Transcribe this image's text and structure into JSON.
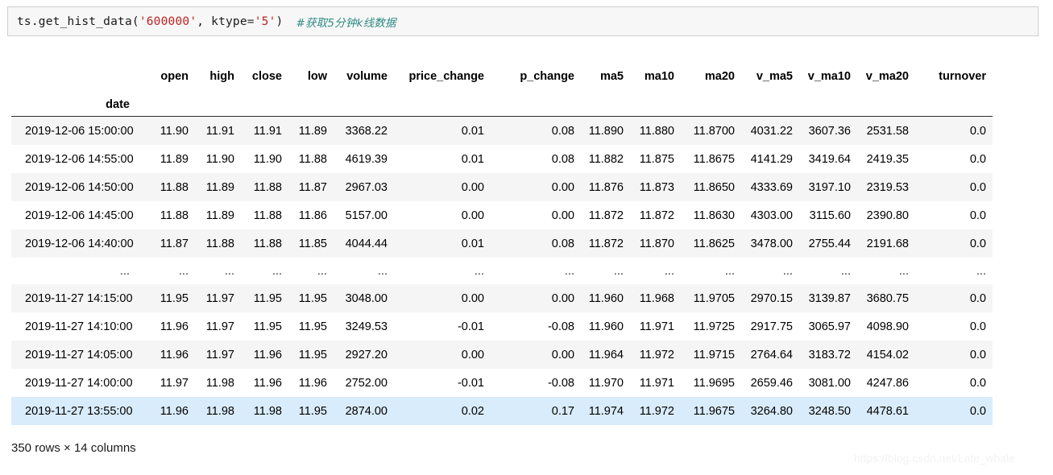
{
  "code_cell": {
    "prefix": "ts.get_hist_data(",
    "arg1": "'600000'",
    "comma": ", ",
    "kwarg_name": "ktype",
    "equals": "=",
    "arg2": "'5'",
    "close_paren": ")",
    "comment": "#获取5分钟k线数据",
    "full_text": "ts.get_hist_data('600000', ktype='5')  #获取5分钟k线数据"
  },
  "dataframe": {
    "index_name": "date",
    "columns": [
      "open",
      "high",
      "close",
      "low",
      "volume",
      "price_change",
      "p_change",
      "ma5",
      "ma10",
      "ma20",
      "v_ma5",
      "v_ma10",
      "v_ma20",
      "turnover"
    ],
    "ellipsis": "...",
    "rows": [
      {
        "index": "2019-12-06 15:00:00",
        "values": [
          "11.90",
          "11.91",
          "11.91",
          "11.89",
          "3368.22",
          "0.01",
          "0.08",
          "11.890",
          "11.880",
          "11.8700",
          "4031.22",
          "3607.36",
          "2531.58",
          "0.0"
        ],
        "highlight": false
      },
      {
        "index": "2019-12-06 14:55:00",
        "values": [
          "11.89",
          "11.90",
          "11.90",
          "11.88",
          "4619.39",
          "0.01",
          "0.08",
          "11.882",
          "11.875",
          "11.8675",
          "4141.29",
          "3419.64",
          "2419.35",
          "0.0"
        ],
        "highlight": false
      },
      {
        "index": "2019-12-06 14:50:00",
        "values": [
          "11.88",
          "11.89",
          "11.88",
          "11.87",
          "2967.03",
          "0.00",
          "0.00",
          "11.876",
          "11.873",
          "11.8650",
          "4333.69",
          "3197.10",
          "2319.53",
          "0.0"
        ],
        "highlight": false
      },
      {
        "index": "2019-12-06 14:45:00",
        "values": [
          "11.88",
          "11.89",
          "11.88",
          "11.86",
          "5157.00",
          "0.00",
          "0.00",
          "11.872",
          "11.872",
          "11.8630",
          "4303.00",
          "3115.60",
          "2390.80",
          "0.0"
        ],
        "highlight": false
      },
      {
        "index": "2019-12-06 14:40:00",
        "values": [
          "11.87",
          "11.88",
          "11.88",
          "11.85",
          "4044.44",
          "0.01",
          "0.08",
          "11.872",
          "11.870",
          "11.8625",
          "3478.00",
          "2755.44",
          "2191.68",
          "0.0"
        ],
        "highlight": false
      },
      {
        "index": "...",
        "values": [
          "...",
          "...",
          "...",
          "...",
          "...",
          "...",
          "...",
          "...",
          "...",
          "...",
          "...",
          "...",
          "...",
          "..."
        ],
        "is_ellipsis": true
      },
      {
        "index": "2019-11-27 14:15:00",
        "values": [
          "11.95",
          "11.97",
          "11.95",
          "11.95",
          "3048.00",
          "0.00",
          "0.00",
          "11.960",
          "11.968",
          "11.9705",
          "2970.15",
          "3139.87",
          "3680.75",
          "0.0"
        ],
        "highlight": false
      },
      {
        "index": "2019-11-27 14:10:00",
        "values": [
          "11.96",
          "11.97",
          "11.95",
          "11.95",
          "3249.53",
          "-0.01",
          "-0.08",
          "11.960",
          "11.971",
          "11.9725",
          "2917.75",
          "3065.97",
          "4098.90",
          "0.0"
        ],
        "highlight": false
      },
      {
        "index": "2019-11-27 14:05:00",
        "values": [
          "11.96",
          "11.97",
          "11.96",
          "11.95",
          "2927.20",
          "0.00",
          "0.00",
          "11.964",
          "11.972",
          "11.9715",
          "2764.64",
          "3183.72",
          "4154.02",
          "0.0"
        ],
        "highlight": false
      },
      {
        "index": "2019-11-27 14:00:00",
        "values": [
          "11.97",
          "11.98",
          "11.96",
          "11.96",
          "2752.00",
          "-0.01",
          "-0.08",
          "11.970",
          "11.971",
          "11.9695",
          "2659.46",
          "3081.00",
          "4247.86",
          "0.0"
        ],
        "highlight": false
      },
      {
        "index": "2019-11-27 13:55:00",
        "values": [
          "11.96",
          "11.98",
          "11.98",
          "11.95",
          "2874.00",
          "0.02",
          "0.17",
          "11.974",
          "11.972",
          "11.9675",
          "3264.80",
          "3248.50",
          "4478.61",
          "0.0"
        ],
        "highlight": true
      }
    ],
    "shape_text": "350 rows × 14 columns"
  },
  "watermark": {
    "text": "https://blog.csdn.net/Late_whale"
  },
  "colors": {
    "code_bg": "#f7f7f7",
    "code_border": "#cfcfcf",
    "string_literal": "#bb2222",
    "comment": "#2e8b82",
    "row_stripe": "#f5f5f5",
    "row_highlight": "#d9ecfb",
    "header_rule": "#2b2b2b",
    "watermark": "#f2f2f2"
  }
}
